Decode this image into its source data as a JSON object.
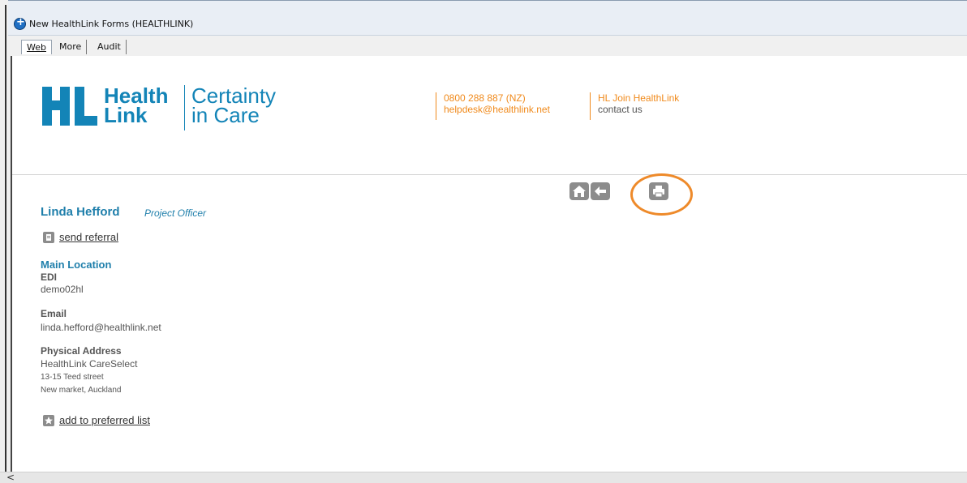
{
  "window": {
    "title": "New HealthLink Forms (HEALTHLINK)"
  },
  "tabs": [
    {
      "label": "Web",
      "active": true
    },
    {
      "label": "More",
      "active": false
    },
    {
      "label": "Audit",
      "active": false
    }
  ],
  "header": {
    "logo": {
      "brand_top": "Health",
      "brand_bottom": "Link",
      "tagline_top": "Certainty",
      "tagline_bottom": "in Care"
    },
    "phone": "0800 288 887 (NZ)",
    "email": "helpdesk@healthlink.net",
    "join": "HL Join HealthLink",
    "contact": "contact us"
  },
  "toolbar": {
    "icons": [
      "home-icon",
      "back-arrow-icon",
      "print-icon"
    ]
  },
  "profile": {
    "name": "Linda Hefford",
    "title": "Project Officer",
    "send_referral": "send referral",
    "location_heading": "Main Location",
    "edi_label": "EDI",
    "edi_value": "demo02hl",
    "email_label": "Email",
    "email_value": "linda.hefford@healthlink.net",
    "address_label": "Physical Address",
    "address_line1": "HealthLink CareSelect",
    "address_line2": "13-15 Teed street",
    "address_line3": "New market, Auckland",
    "preferred": "add to preferred list"
  },
  "colors": {
    "brand": "#1384b7",
    "accent": "#f08a1c",
    "heading": "#1f7fab",
    "highlight": "#ee8a2a"
  },
  "scrollbar": {
    "left_arrow": "<"
  }
}
